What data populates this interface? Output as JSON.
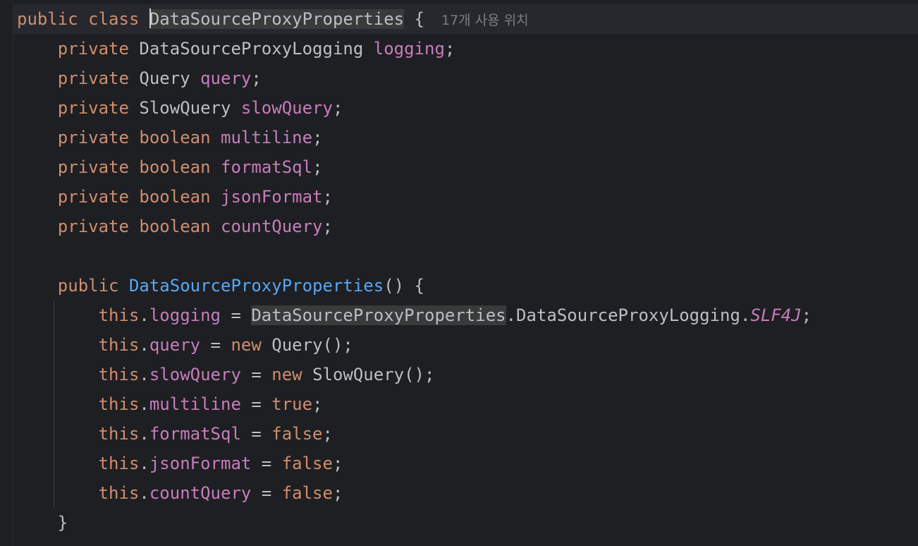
{
  "usage_hint": "17개 사용 위치",
  "tokens": {
    "public": "public",
    "class": "class",
    "private": "private",
    "boolean": "boolean",
    "this": "this",
    "new": "new",
    "true": "true",
    "false": "false",
    "class_name": "DataSourceProxyProperties",
    "type_logging": "DataSourceProxyLogging",
    "type_query": "Query",
    "type_slow_query": "SlowQuery",
    "field_logging": "logging",
    "field_query": "query",
    "field_slow_query": "slowQuery",
    "field_multiline": "multiline",
    "field_format_sql": "formatSql",
    "field_json_format": "jsonFormat",
    "field_count_query": "countQuery",
    "const_slf4j": "SLF4J"
  }
}
